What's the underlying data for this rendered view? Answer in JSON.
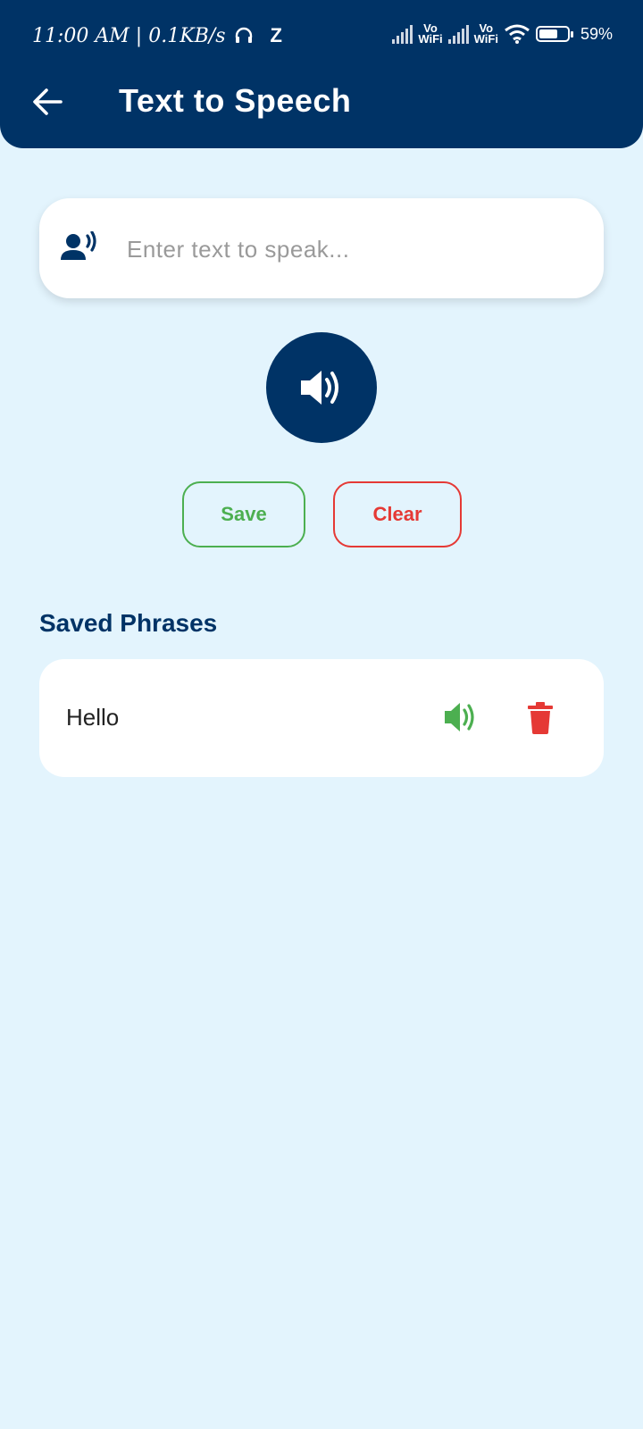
{
  "status": {
    "time_speed": "11:00 AM | 0.1KB/s",
    "z_label": "Z",
    "vowifi_1": "Vo\nWiFi",
    "vowifi_2": "Vo\nWiFi",
    "battery": "59%"
  },
  "header": {
    "title": "Text to Speech"
  },
  "input": {
    "placeholder": "Enter text to speak...",
    "value": ""
  },
  "actions": {
    "save_label": "Save",
    "clear_label": "Clear"
  },
  "saved": {
    "title": "Saved Phrases",
    "items": [
      {
        "text": "Hello"
      }
    ]
  },
  "colors": {
    "primary": "#003366",
    "background": "#e3f4fd",
    "save": "#4caf50",
    "clear": "#e53935"
  },
  "icons": {
    "back": "arrow-left-icon",
    "input": "voice-person-icon",
    "speak": "speaker-icon",
    "phrase_play": "speaker-icon",
    "phrase_delete": "trash-icon"
  }
}
